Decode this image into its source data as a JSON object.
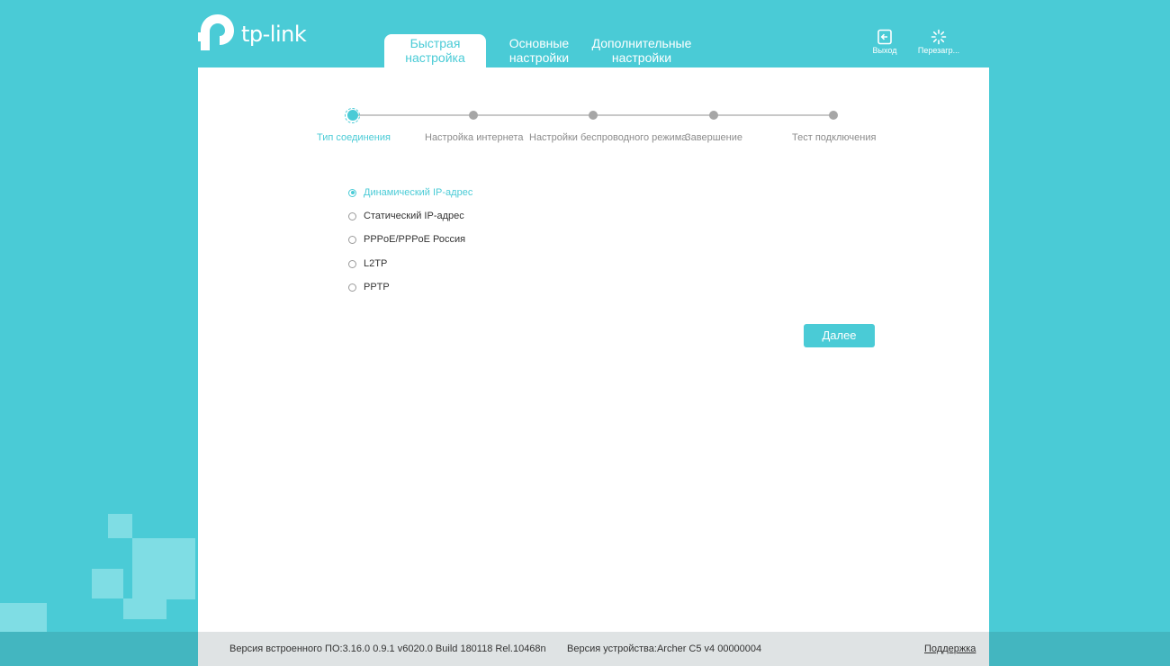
{
  "brand": {
    "logo_text": "tp-link"
  },
  "tabs": [
    {
      "line1": "Быстрая",
      "line2": "настройка",
      "active": true
    },
    {
      "line1": "Основные",
      "line2": "настройки",
      "active": false
    },
    {
      "line1": "Дополнительные",
      "line2": "настройки",
      "active": false
    }
  ],
  "header_actions": {
    "logout_label": "Выход",
    "reboot_label": "Перезагр..."
  },
  "wizard": {
    "steps": [
      {
        "label": "Тип соединения",
        "active": true
      },
      {
        "label": "Настройка интернета",
        "active": false
      },
      {
        "label": "Настройки беспроводного режима",
        "active": false
      },
      {
        "label": "Завершение",
        "active": false
      },
      {
        "label": "Тест подключения",
        "active": false
      }
    ],
    "connection_types": [
      {
        "label": "Динамический IP-адрес",
        "checked": true
      },
      {
        "label": "Статический IP-адрес",
        "checked": false
      },
      {
        "label": "PPPoE/PPPoE Россия",
        "checked": false
      },
      {
        "label": "L2TP",
        "checked": false
      },
      {
        "label": "PPTP",
        "checked": false
      }
    ],
    "next_label": "Далее"
  },
  "footer": {
    "firmware": "Версия встроенного ПО:3.16.0 0.9.1 v6020.0 Build 180118 Rel.10468n",
    "hardware": "Версия устройства:Archer C5 v4 00000004",
    "support_label": "Поддержка"
  },
  "colors": {
    "accent": "#4acbd6",
    "background": "#4acbd6",
    "panel": "#ffffff",
    "footer": "#dfe3e4"
  }
}
